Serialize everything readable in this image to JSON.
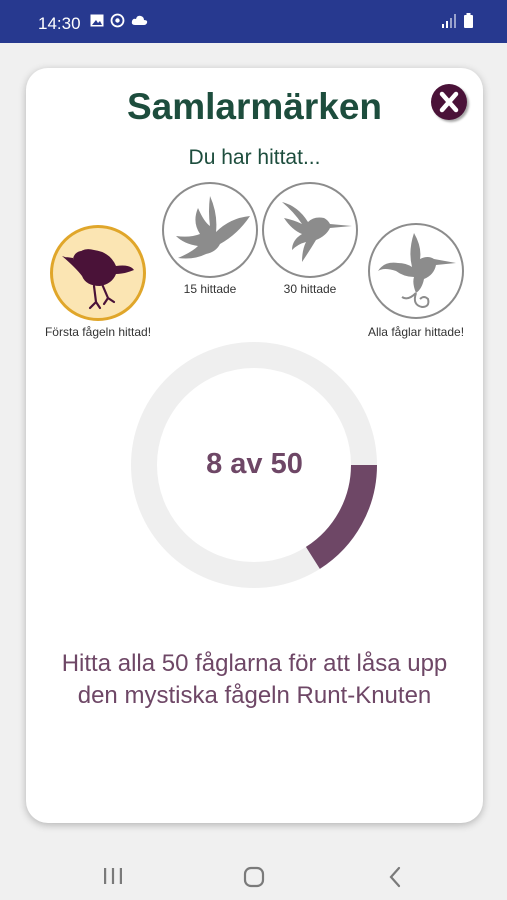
{
  "status_bar": {
    "time": "14:30"
  },
  "modal": {
    "title": "Samlarmärken",
    "subtitle": "Du har hittat...",
    "close_icon": "close-x-icon",
    "badges": [
      {
        "label": "Första fågeln hittad!",
        "icon": "robin-icon",
        "unlocked": true
      },
      {
        "label": "15 hittade",
        "icon": "swallow-icon",
        "unlocked": false
      },
      {
        "label": "30 hittade",
        "icon": "hummingbird-icon",
        "unlocked": false
      },
      {
        "label": "Alla fåglar hittade!",
        "icon": "ornate-bird-icon",
        "unlocked": false
      }
    ],
    "progress": {
      "text": "8 av 50",
      "found": 8,
      "total": 50
    },
    "message": "Hitta alla 50 fåglarna för att låsa upp den mystiska fågeln Runt-Knuten"
  },
  "colors": {
    "status_bar": "#27398f",
    "title": "#1d4d3d",
    "accent": "#6e4766",
    "close_button": "#4a1238",
    "unlocked_fill": "#fbe5b3",
    "unlocked_border": "#e0a62a",
    "locked_icon": "#8c8c8c"
  }
}
